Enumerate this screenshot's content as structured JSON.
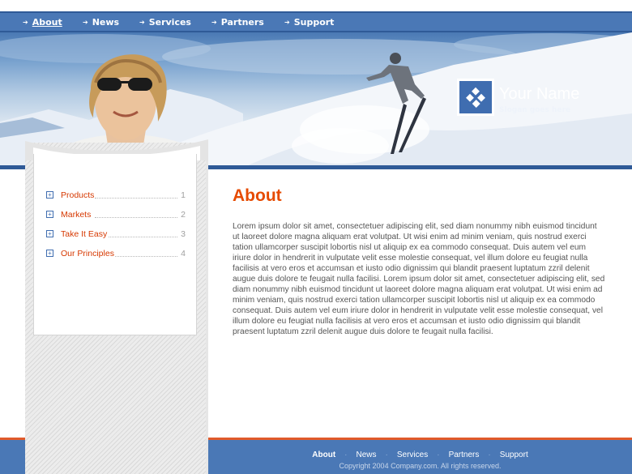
{
  "colors": {
    "nav_bg": "#4a78b6",
    "accent_orange": "#e64a00",
    "menu_link": "#d63800",
    "footer_rule": "#e05a2a"
  },
  "topnav": {
    "items": [
      {
        "label": "About",
        "icon": "arrow-icon",
        "active": true
      },
      {
        "label": "News",
        "icon": "arrow-icon"
      },
      {
        "label": "Services",
        "icon": "arrow-icon"
      },
      {
        "label": "Partners",
        "icon": "arrow-icon"
      },
      {
        "label": "Support",
        "icon": "arrow-icon"
      }
    ]
  },
  "brand": {
    "name": "Your Name",
    "slogan": "Slogan goes here"
  },
  "sidebar": {
    "items": [
      {
        "label": "Products",
        "num": "1"
      },
      {
        "label": "Markets",
        "num": "2"
      },
      {
        "label": "Take It Easy",
        "num": "3"
      },
      {
        "label": "Our Principles",
        "num": "4"
      }
    ]
  },
  "main": {
    "title": "About",
    "body": "Lorem ipsum dolor sit amet, consectetuer adipiscing elit, sed diam nonummy nibh euismod tincidunt ut laoreet dolore magna aliquam erat volutpat. Ut wisi enim ad minim veniam, quis nostrud exerci tation ullamcorper suscipit lobortis nisl ut aliquip ex ea commodo consequat. Duis autem vel eum iriure dolor in hendrerit in vulputate velit esse molestie consequat, vel illum dolore eu feugiat nulla facilisis at vero eros et accumsan et iusto odio dignissim qui blandit praesent luptatum zzril delenit augue duis dolore te feugait nulla facilisi. Lorem ipsum dolor sit amet, consectetuer adipiscing elit, sed diam nonummy nibh euismod tincidunt ut laoreet dolore magna aliquam erat volutpat. Ut wisi enim ad minim veniam, quis nostrud exerci tation ullamcorper suscipit lobortis nisl ut aliquip ex ea commodo consequat. Duis autem vel eum iriure dolor in hendrerit in vulputate velit esse molestie consequat, vel illum dolore eu feugiat nulla facilisis at vero eros et accumsan et iusto odio dignissim qui blandit praesent luptatum zzril delenit augue duis dolore te feugait nulla facilisi."
  },
  "footer": {
    "links": [
      "About",
      "News",
      "Services",
      "Partners",
      "Support"
    ],
    "copyright": "Copyright 2004 Company.com. All rights reserved."
  }
}
